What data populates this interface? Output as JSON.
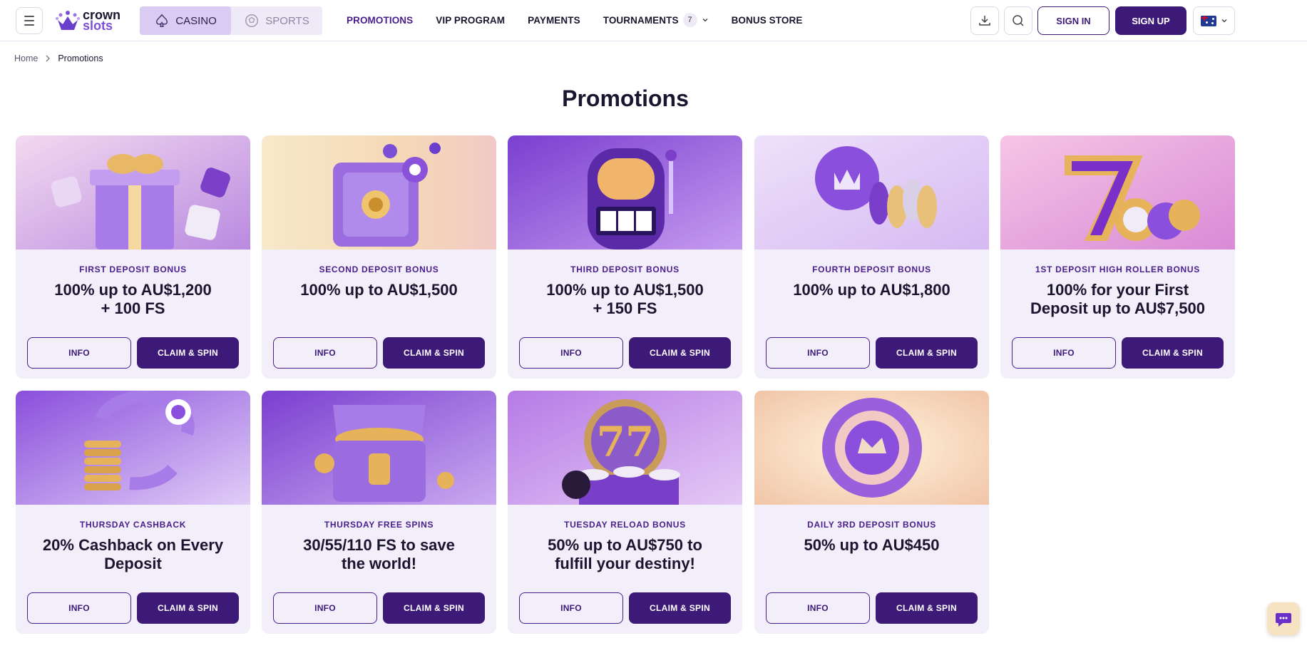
{
  "header": {
    "logo": {
      "line1": "crown",
      "line2": "slots"
    },
    "modes": [
      {
        "label": "CASINO",
        "active": true
      },
      {
        "label": "SPORTS",
        "active": false
      }
    ],
    "nav": [
      {
        "label": "PROMOTIONS",
        "active": true
      },
      {
        "label": "VIP PROGRAM"
      },
      {
        "label": "PAYMENTS"
      },
      {
        "label": "TOURNAMENTS",
        "badge": "7"
      },
      {
        "label": "BONUS STORE"
      }
    ],
    "sign_in": "SIGN IN",
    "sign_up": "SIGN UP",
    "icons": [
      "menu-icon",
      "download-icon",
      "search-icon",
      "chevron-down-icon"
    ]
  },
  "breadcrumb": {
    "home": "Home",
    "current": "Promotions"
  },
  "page_title": "Promotions",
  "buttons": {
    "info": "INFO",
    "claim": "CLAIM & SPIN"
  },
  "promos": [
    {
      "subtitle": "FIRST DEPOSIT BONUS",
      "title_l1": "100% up to AU$1,200",
      "title_l2": "+ 100 FS"
    },
    {
      "subtitle": "SECOND DEPOSIT BONUS",
      "title_l1": "100% up to AU$1,500",
      "title_l2": ""
    },
    {
      "subtitle": "THIRD DEPOSIT BONUS",
      "title_l1": "100% up to AU$1,500",
      "title_l2": "+ 150 FS"
    },
    {
      "subtitle": "FOURTH DEPOSIT BONUS",
      "title_l1": "100% up to AU$1,800",
      "title_l2": ""
    },
    {
      "subtitle": "1ST DEPOSIT HIGH ROLLER BONUS",
      "title_l1": "100% for your First",
      "title_l2": "Deposit up to AU$7,500"
    },
    {
      "subtitle": "THURSDAY CASHBACK",
      "title_l1": "20% Cashback on Every",
      "title_l2": "Deposit"
    },
    {
      "subtitle": "THURSDAY FREE SPINS",
      "title_l1": "30/55/110 FS to save",
      "title_l2": "the world!"
    },
    {
      "subtitle": "TUESDAY RELOAD BONUS",
      "title_l1": "50% up to AU$750 to",
      "title_l2": "fulfill your destiny!"
    },
    {
      "subtitle": "DAILY 3RD DEPOSIT BONUS",
      "title_l1": "50% up to AU$450",
      "title_l2": ""
    }
  ],
  "colors": {
    "accent": "#3d1a78",
    "accent_light": "#4a1e8c",
    "card_bg": "#f2eefa"
  }
}
